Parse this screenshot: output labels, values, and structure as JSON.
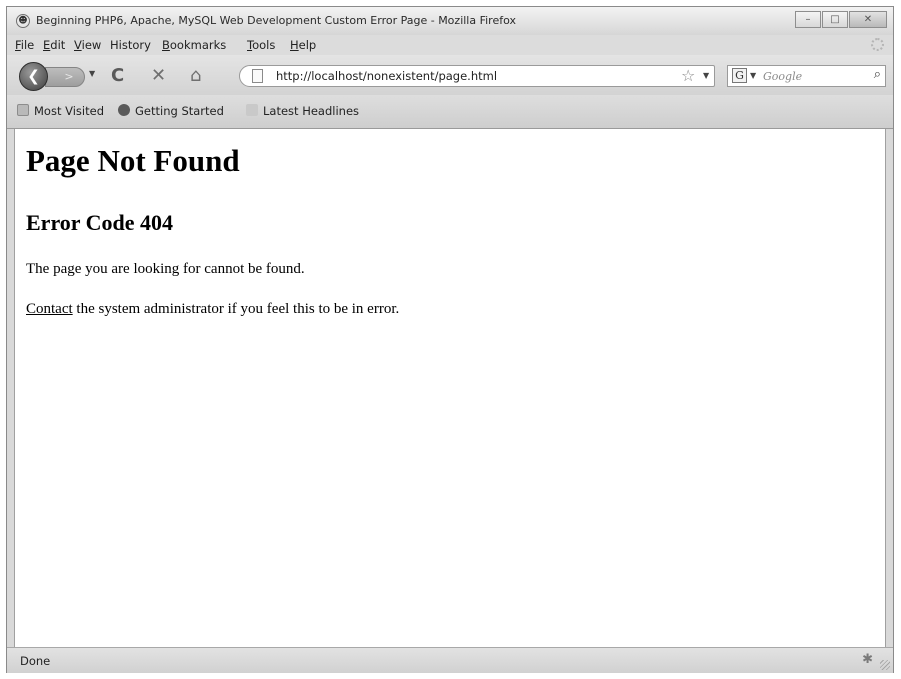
{
  "window": {
    "title": "Beginning PHP6, Apache, MySQL Web Development Custom Error Page - Mozilla Firefox",
    "minimize_symbol": "–",
    "maximize_symbol": "□",
    "close_symbol": "✕"
  },
  "menu": {
    "items": [
      {
        "mnemonic": "F",
        "rest": "ile"
      },
      {
        "mnemonic": "E",
        "rest": "dit"
      },
      {
        "mnemonic": "V",
        "rest": "iew"
      },
      {
        "mnemonic": "",
        "rest": "History"
      },
      {
        "mnemonic": "B",
        "rest": "ookmarks"
      },
      {
        "mnemonic": "T",
        "rest": "ools"
      },
      {
        "mnemonic": "H",
        "rest": "elp"
      }
    ]
  },
  "toolbar": {
    "address": "http://localhost/nonexistent/page.html",
    "search_placeholder": "Google",
    "search_engine_letter": "G"
  },
  "bookmarks": {
    "items": [
      "Most Visited",
      "Getting Started",
      "Latest Headlines"
    ]
  },
  "page": {
    "heading": "Page Not Found",
    "subheading": "Error Code 404",
    "message": "The page you are looking for cannot be found.",
    "contact_link": "Contact",
    "contact_rest": " the system administrator if you feel this to be in error."
  },
  "status": {
    "text": "Done"
  },
  "icons": {
    "app": "firefox-icon",
    "back": "back-arrow-icon",
    "forward": "forward-arrow-icon",
    "reload": "reload-icon",
    "stop": "stop-icon",
    "home": "home-icon",
    "bookmark": "star-icon",
    "search": "magnifier-icon"
  },
  "colors": {
    "chrome": "#d9d9d9",
    "page_background": "#ffffff",
    "text": "#000000"
  }
}
